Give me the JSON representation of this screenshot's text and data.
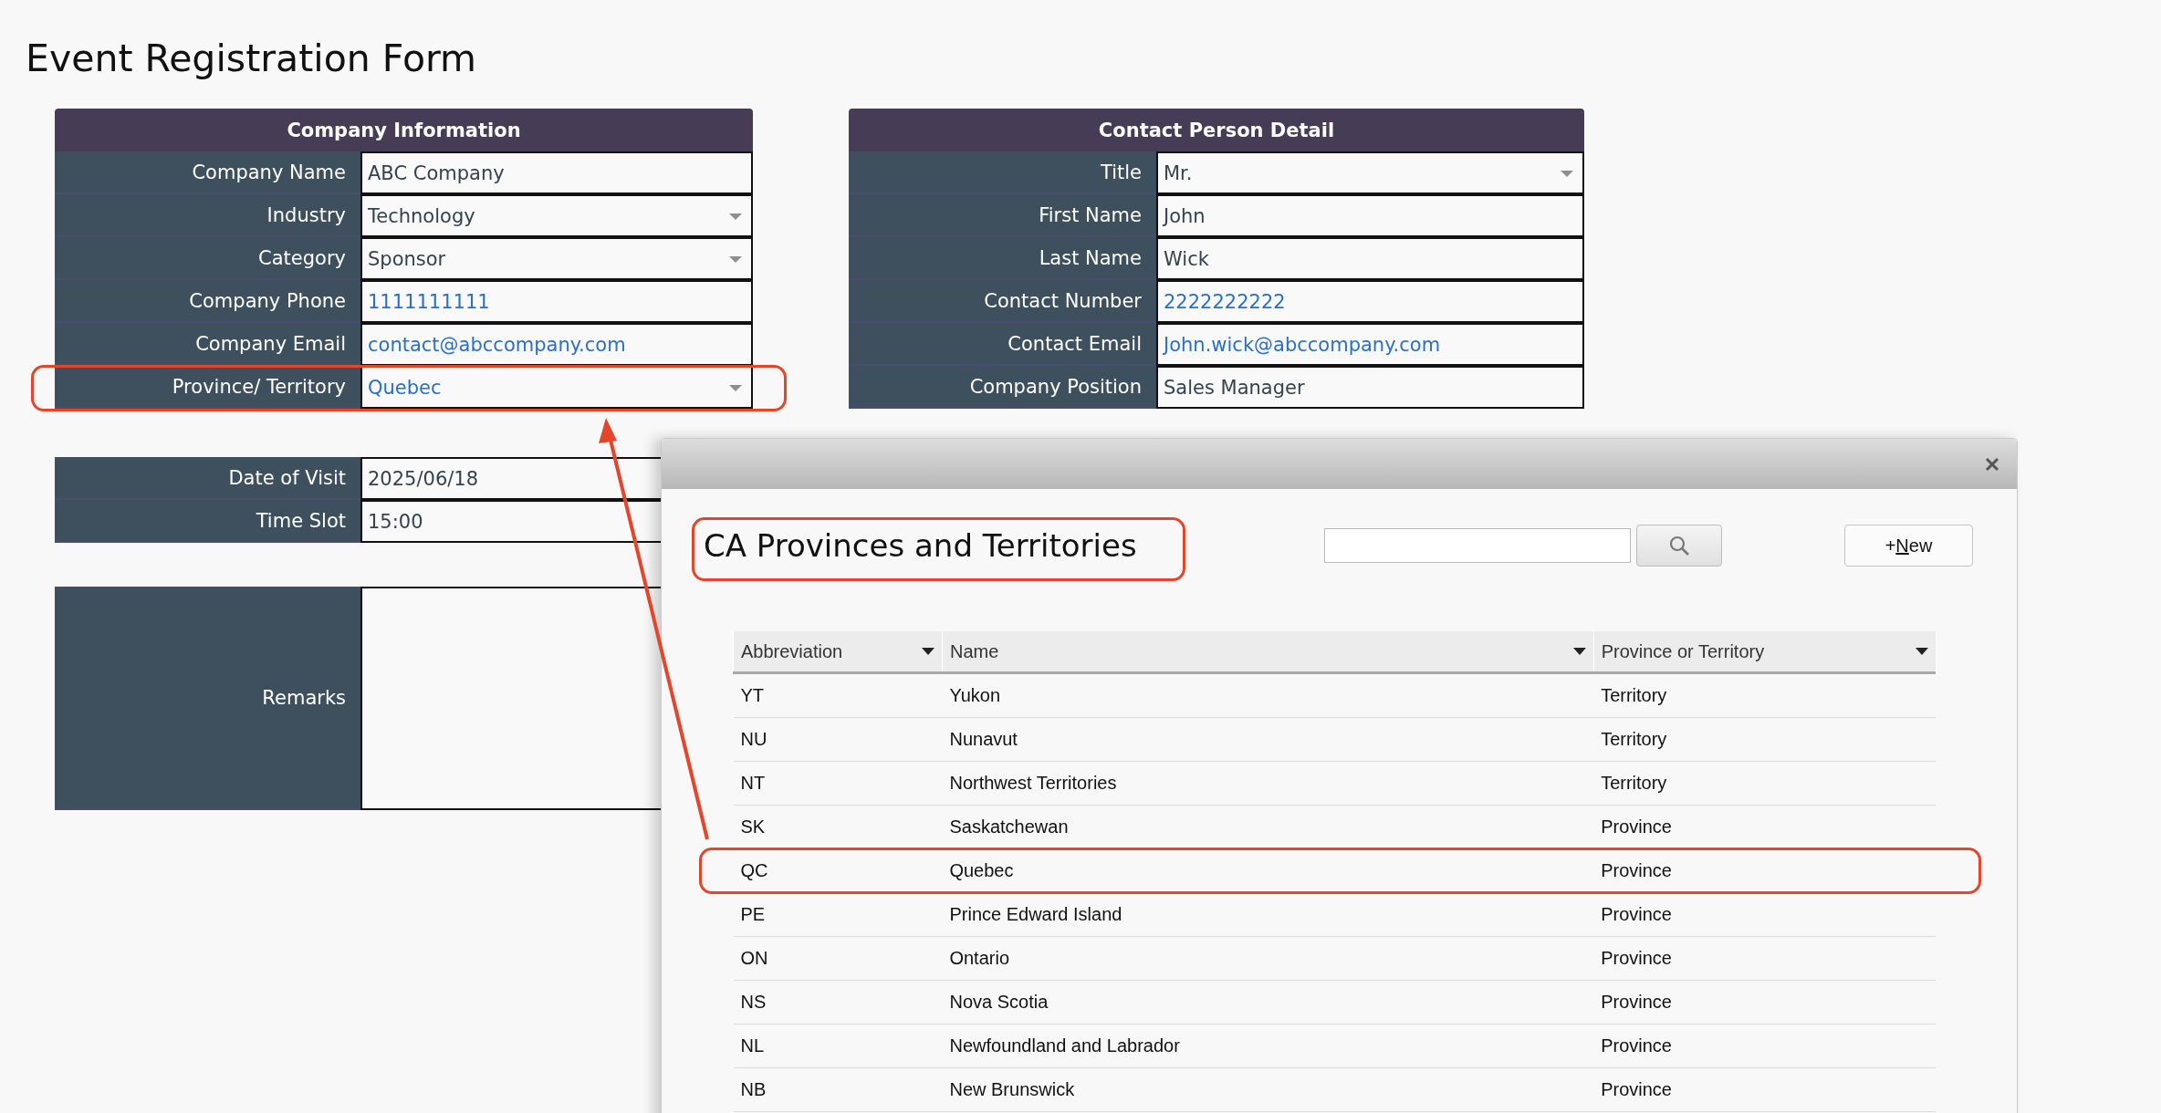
{
  "page_title": "Event Registration Form",
  "company_information": {
    "heading": "Company Information",
    "fields": [
      {
        "label": "Company Name",
        "value": "ABC Company",
        "kind": "text",
        "linked": false,
        "annotated": false
      },
      {
        "label": "Industry",
        "value": "Technology",
        "kind": "dropdown",
        "linked": false,
        "annotated": false
      },
      {
        "label": "Category",
        "value": "Sponsor",
        "kind": "dropdown",
        "linked": false,
        "annotated": false
      },
      {
        "label": "Company Phone",
        "value": "1111111111",
        "kind": "text",
        "linked": true,
        "annotated": false
      },
      {
        "label": "Company Email",
        "value": "contact@abccompany.com",
        "kind": "text",
        "linked": true,
        "annotated": false
      },
      {
        "label": "Province/ Territory",
        "value": "Quebec",
        "kind": "dropdown",
        "linked": true,
        "annotated": true
      }
    ]
  },
  "contact_person_detail": {
    "heading": "Contact Person Detail",
    "fields": [
      {
        "label": "Title",
        "value": "Mr.",
        "kind": "dropdown",
        "linked": false,
        "annotated": false
      },
      {
        "label": "First Name",
        "value": "John",
        "kind": "text",
        "linked": false,
        "annotated": false
      },
      {
        "label": "Last Name",
        "value": "Wick",
        "kind": "text",
        "linked": false,
        "annotated": false
      },
      {
        "label": "Contact Number",
        "value": "2222222222",
        "kind": "text",
        "linked": true,
        "annotated": false
      },
      {
        "label": "Contact Email",
        "value": "John.wick@abccompany.com",
        "kind": "text",
        "linked": true,
        "annotated": false
      },
      {
        "label": "Company Position",
        "value": "Sales Manager",
        "kind": "text",
        "linked": false,
        "annotated": false
      }
    ]
  },
  "visit": {
    "fields": [
      {
        "label": "Date of Visit",
        "value": "2025/06/18",
        "linked": false,
        "annotated": false
      },
      {
        "label": "Time Slot",
        "value": "15:00",
        "linked": false,
        "annotated": false
      }
    ]
  },
  "remarks": {
    "label": "Remarks"
  },
  "lookup_dialog": {
    "title": "CA Provinces and Territories",
    "title_annotated": true,
    "new_button": {
      "text_before": "+",
      "access_key": "N",
      "text_after": "ew"
    },
    "columns": [
      {
        "label": "Abbreviation"
      },
      {
        "label": "Name"
      },
      {
        "label": "Province or Territory"
      }
    ],
    "rows": [
      {
        "cells": [
          "YT",
          "Yukon",
          "Territory"
        ],
        "annotated": false
      },
      {
        "cells": [
          "NU",
          "Nunavut",
          "Territory"
        ],
        "annotated": false
      },
      {
        "cells": [
          "NT",
          "Northwest Territories",
          "Territory"
        ],
        "annotated": false
      },
      {
        "cells": [
          "SK",
          "Saskatchewan",
          "Province"
        ],
        "annotated": false
      },
      {
        "cells": [
          "QC",
          "Quebec",
          "Province"
        ],
        "annotated": true
      },
      {
        "cells": [
          "PE",
          "Prince Edward Island",
          "Province"
        ],
        "annotated": false
      },
      {
        "cells": [
          "ON",
          "Ontario",
          "Province"
        ],
        "annotated": false
      },
      {
        "cells": [
          "NS",
          "Nova Scotia",
          "Province"
        ],
        "annotated": false
      },
      {
        "cells": [
          "NL",
          "Newfoundland and Labrador",
          "Province"
        ],
        "annotated": false
      },
      {
        "cells": [
          "NB",
          "New Brunswick",
          "Province"
        ],
        "annotated": false
      }
    ]
  }
}
